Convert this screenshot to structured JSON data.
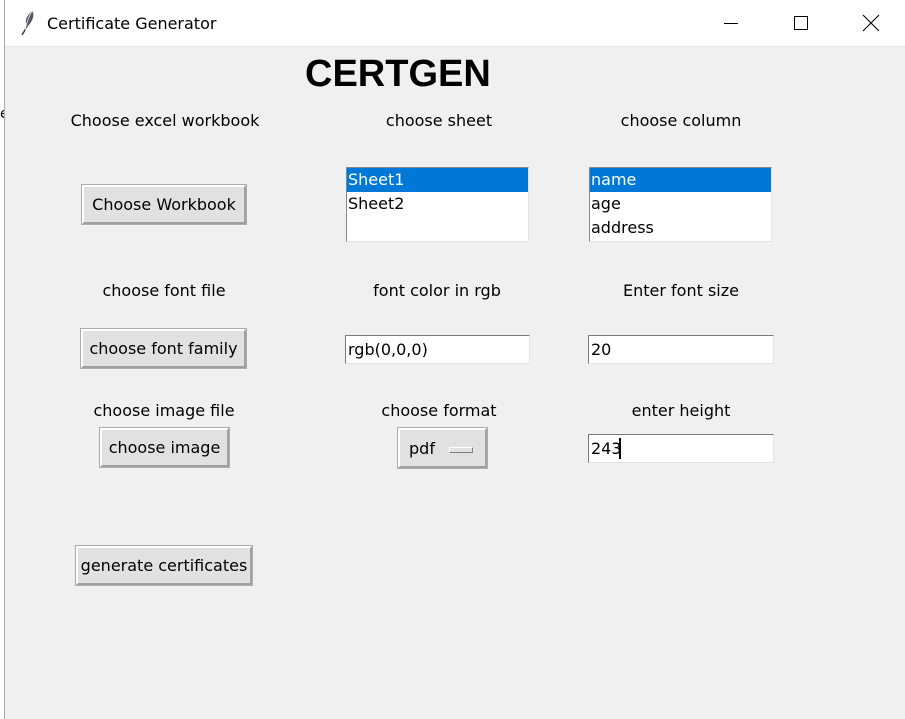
{
  "window": {
    "title": "Certificate Generator",
    "icon": "feather-icon",
    "controls": {
      "minimize_icon": "minimize-icon",
      "maximize_icon": "maximize-icon",
      "close_icon": "close-icon"
    }
  },
  "app": {
    "heading": "CERTGEN"
  },
  "workbook": {
    "label": "Choose excel workbook",
    "button": "Choose Workbook"
  },
  "sheet": {
    "label": "choose sheet",
    "items": [
      "Sheet1",
      "Sheet2"
    ],
    "selected": "Sheet1"
  },
  "column": {
    "label": "choose column",
    "items": [
      "name",
      "age",
      "address"
    ],
    "selected": "name"
  },
  "font_file": {
    "label": "choose font file",
    "button": "choose font family"
  },
  "font_color": {
    "label": "font color in rgb",
    "value": "rgb(0,0,0)"
  },
  "font_size": {
    "label": "Enter font size",
    "value": "20"
  },
  "image_file": {
    "label": "choose image file",
    "button": "choose image"
  },
  "format": {
    "label": "choose format",
    "selected": "pdf"
  },
  "height": {
    "label": "enter height",
    "value": "243"
  },
  "generate": {
    "button": "generate certificates"
  },
  "colors": {
    "selection": "#0078d7",
    "window_bg": "#f0f0f0",
    "button_bg": "#e1e1e1"
  }
}
